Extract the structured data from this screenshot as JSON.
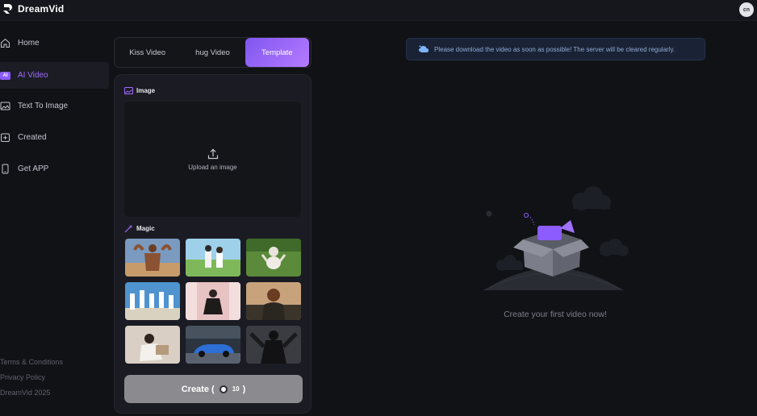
{
  "app": {
    "name": "DreamVid",
    "avatar_initials": "cn"
  },
  "sidebar": {
    "items": [
      {
        "label": "Home",
        "icon": "home-icon",
        "active": false
      },
      {
        "label": "AI Video",
        "icon": "ai-video-icon",
        "badge": "AI",
        "active": true
      },
      {
        "label": "Text To Image",
        "icon": "image-icon",
        "active": false
      },
      {
        "label": "Created",
        "icon": "created-icon",
        "active": false
      },
      {
        "label": "Get APP",
        "icon": "phone-icon",
        "active": false
      }
    ],
    "footer": [
      "Terms & Conditions",
      "Privacy Policy",
      "DreamVid 2025"
    ]
  },
  "tabs": [
    {
      "label": "Kiss Video",
      "selected": false
    },
    {
      "label": "hug Video",
      "selected": false
    },
    {
      "label": "Template",
      "selected": true
    }
  ],
  "panel": {
    "image_label": "Image",
    "upload_text": "Upload an image",
    "magic_label": "Magic",
    "templates": [
      {
        "name": "flexing-man",
        "icon": "template-thumbnail"
      },
      {
        "name": "couple-field",
        "icon": "template-thumbnail"
      },
      {
        "name": "cat-grass",
        "icon": "template-thumbnail"
      },
      {
        "name": "group-jump",
        "icon": "template-thumbnail"
      },
      {
        "name": "dancing-woman",
        "icon": "template-thumbnail"
      },
      {
        "name": "smiling-man",
        "icon": "template-thumbnail"
      },
      {
        "name": "woman-reading",
        "icon": "template-thumbnail"
      },
      {
        "name": "blue-car",
        "icon": "template-thumbnail"
      },
      {
        "name": "superhero",
        "icon": "template-thumbnail"
      }
    ],
    "create_label": "Create (",
    "create_cost": "10",
    "create_close": ")"
  },
  "notice": {
    "text": "Please download the video as soon as possible! The server will be cleared regularly."
  },
  "empty_state": {
    "text": "Create your first video now!"
  },
  "colors": {
    "accent": "#8d5cff",
    "background": "#111216",
    "panel": "#1b1c23"
  }
}
